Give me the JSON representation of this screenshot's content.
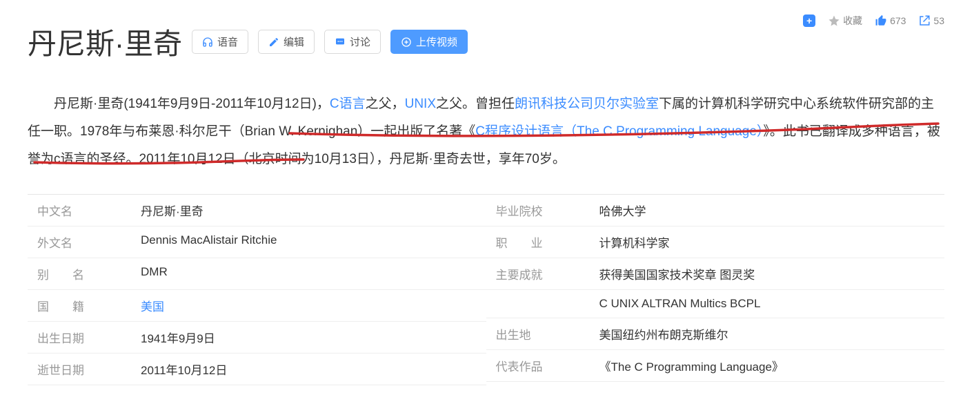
{
  "topbar": {
    "favorite_label": "收藏",
    "like_count": "673",
    "share_count": "53"
  },
  "title": "丹尼斯·里奇",
  "buttons": {
    "audio": "语音",
    "edit": "编辑",
    "discuss": "讨论",
    "upload": "上传视频"
  },
  "intro": {
    "p1a": "丹尼斯·里奇(1941年9月9日-2011年10月12日)，",
    "link1": "C语言",
    "p1b": "之父，",
    "link2": "UNIX",
    "p1c": "之父。曾担任",
    "link3": "朗讯科技公司",
    "link4": "贝尔实验室",
    "p1d": "下属的计算机科学研究中心系统软件研究部的主任一职。1978年与布莱恩·科尔尼干（Brian W. Kernighan）一起出版了名著《",
    "link5": "C程序设计语言（The C Programming Language）",
    "p1e": "》。此书已翻译成多种语言，被誉为c语言的圣经。2011年10月12日（北京时间为10月13日），丹尼斯·里奇去世，享年70岁。"
  },
  "info_left": [
    {
      "label": "中文名",
      "value": "丹尼斯·里奇"
    },
    {
      "label": "外文名",
      "value": "Dennis MacAlistair Ritchie"
    },
    {
      "label": "别　　名",
      "value": "DMR"
    },
    {
      "label": "国　　籍",
      "value": "美国",
      "link": true
    },
    {
      "label": "出生日期",
      "value": "1941年9月9日"
    },
    {
      "label": "逝世日期",
      "value": "2011年10月12日"
    }
  ],
  "info_right": [
    {
      "label": "毕业院校",
      "value": "哈佛大学"
    },
    {
      "label": "职　　业",
      "value": "计算机科学家"
    },
    {
      "label": "主要成就",
      "value": "获得美国国家技术奖章 图灵奖"
    },
    {
      "label": "",
      "value": "C UNIX ALTRAN Multics BCPL"
    },
    {
      "label": "出生地",
      "value": "美国纽约州布朗克斯维尔"
    },
    {
      "label": "代表作品",
      "value": "《The C Programming Language》"
    }
  ]
}
